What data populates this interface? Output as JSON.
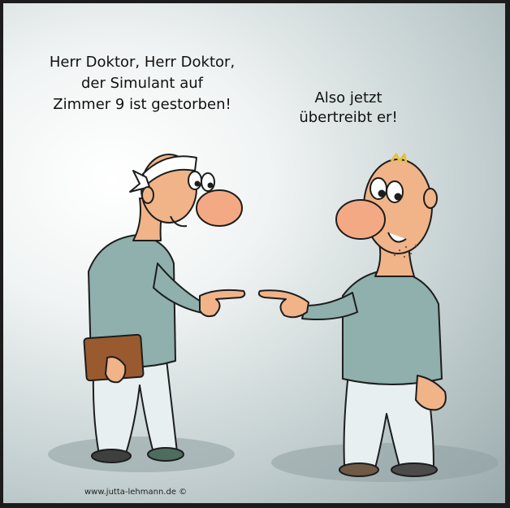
{
  "speech_bubbles": {
    "left": "Herr Doktor, Herr Doktor,\nder Simulant auf\nZimmer 9 ist gestorben!",
    "right": "Also jetzt\nübertreibt er!"
  },
  "credit": "www.jutta-lehmann.de ©",
  "colors": {
    "shirt": "#8fb0ad",
    "pants": "#e7eff0",
    "skin": "#f0b488",
    "book": "#9a5a2f",
    "outline": "#1d1d1d"
  }
}
